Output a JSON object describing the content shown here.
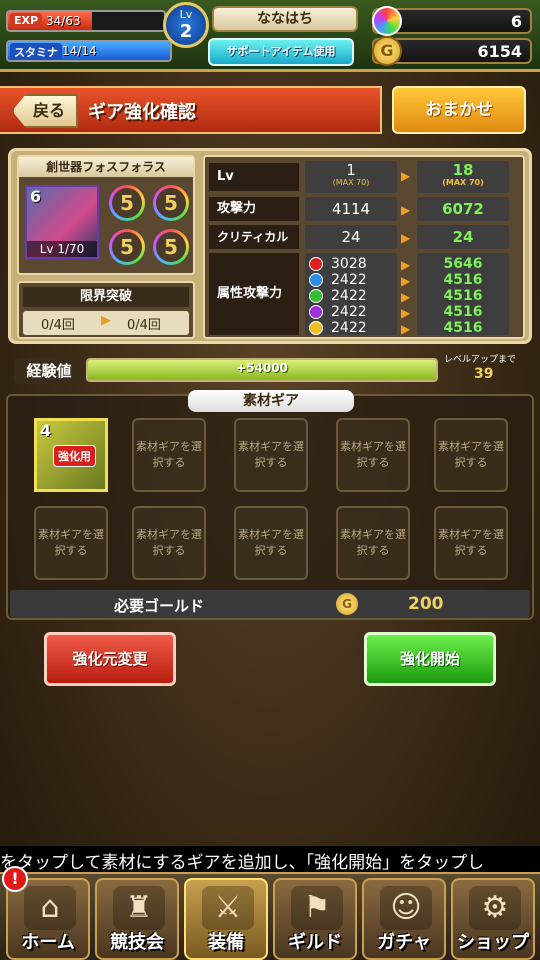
{
  "status": {
    "exp_tag": "EXP",
    "exp_value": "34/63",
    "exp_fraction": 0.54,
    "stamina_tag": "スタミナ",
    "stamina_value": "14/14",
    "stamina_fraction": 1.0,
    "level_label": "Lv",
    "level": "2",
    "player_name": "ななはち",
    "support_button": "サポートアイテム使用",
    "gems": "6",
    "gold": "6154",
    "gold_glyph": "G"
  },
  "header": {
    "back_label": "戻る",
    "title": "ギア強化確認",
    "auto_label": "おまかせ"
  },
  "gear": {
    "name": "創世器フォスフォラス",
    "rarity": "6",
    "level_text": "Lv 1/70",
    "slots": [
      "5",
      "5",
      "5",
      "5"
    ],
    "limit_break": {
      "title": "限界突破",
      "current": "0/4回",
      "after": "0/4回"
    }
  },
  "stats": {
    "lv": {
      "label": "Lv",
      "current": "1",
      "current_max": "(MAX 70)",
      "after": "18",
      "after_max": "(MAX 70)"
    },
    "attack": {
      "label": "攻撃力",
      "current": "4114",
      "after": "6072"
    },
    "critical": {
      "label": "クリティカル",
      "current": "24",
      "after": "24"
    },
    "element_label": "属性攻撃力",
    "elements": [
      {
        "color": "#e02020",
        "current": "3028",
        "after": "5646"
      },
      {
        "color": "#2a8ae8",
        "current": "2422",
        "after": "4516"
      },
      {
        "color": "#30c030",
        "current": "2422",
        "after": "4516"
      },
      {
        "color": "#a030e0",
        "current": "2422",
        "after": "4516"
      },
      {
        "color": "#f0c020",
        "current": "2422",
        "after": "4516"
      }
    ]
  },
  "exp": {
    "label": "経験値",
    "gain": "+54000",
    "fill_fraction": 1.0,
    "levelup_caption": "レベルアップまで",
    "levelup_remaining": "39"
  },
  "materials": {
    "title": "素材ギア",
    "filled": {
      "rarity": "4",
      "badge": "強化用"
    },
    "empty_label": "素材ギアを選択する",
    "required_gold_label": "必要ゴールド",
    "required_gold": "200"
  },
  "actions": {
    "change_base": "強化元変更",
    "start": "強化開始"
  },
  "ticker": "をタップして素材にするギアを追加し、「強化開始」をタップし",
  "nav": [
    {
      "label": "ホーム",
      "icon": "home-icon",
      "glyph": "⌂"
    },
    {
      "label": "競技会",
      "icon": "arena-icon",
      "glyph": "♜"
    },
    {
      "label": "装備",
      "icon": "equipment-icon",
      "glyph": "⚔"
    },
    {
      "label": "ギルド",
      "icon": "guild-flag-icon",
      "glyph": "⚑"
    },
    {
      "label": "ガチャ",
      "icon": "gacha-icon",
      "glyph": "☺"
    },
    {
      "label": "ショップ",
      "icon": "shop-icon",
      "glyph": "⚙"
    }
  ],
  "alert_glyph": "!"
}
